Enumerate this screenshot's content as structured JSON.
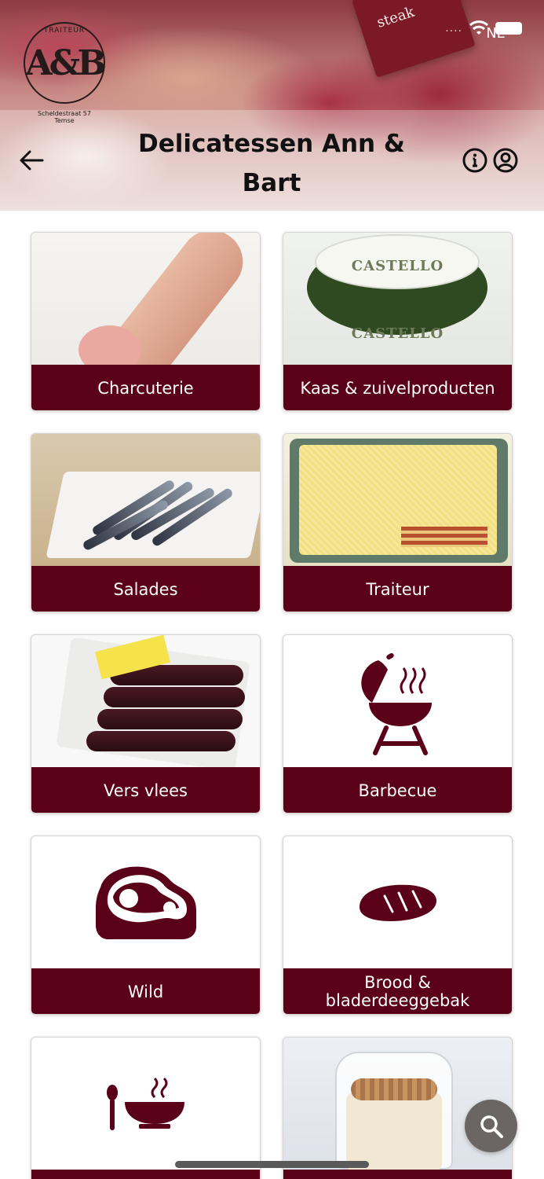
{
  "header": {
    "title": "Delicatessen Ann & Bart",
    "logo": {
      "mark": "A&B",
      "top_text": "TRAITEUR",
      "caption": [
        "Scheldestraat 57",
        "Temse"
      ]
    },
    "sign_text": "steak",
    "back_icon": "arrow-left-icon",
    "info_icon": "info-circle-icon",
    "account_icon": "user-circle-icon"
  },
  "status_bar": {
    "signal": "....",
    "lang": "NL"
  },
  "categories": [
    {
      "label": "Charcuterie",
      "media": "photo"
    },
    {
      "label": "Kaas & zuivelproducten",
      "media": "photo",
      "photo_text": "CASTELLO"
    },
    {
      "label": "Salades",
      "media": "photo"
    },
    {
      "label": "Traiteur",
      "media": "photo"
    },
    {
      "label": "Vers vlees",
      "media": "photo"
    },
    {
      "label": "Barbecue",
      "media": "barbecue-icon"
    },
    {
      "label": "Wild",
      "media": "meat-icon"
    },
    {
      "label": "Brood & bladerdeeggebak",
      "media": "bread-icon"
    },
    {
      "label": "",
      "media": "soup-icon"
    },
    {
      "label": "",
      "media": "photo"
    }
  ],
  "colors": {
    "label_bg": "#5b0019",
    "icon": "#5b0019",
    "fab_bg": "#6b6563"
  },
  "fab": {
    "icon": "search-icon"
  }
}
